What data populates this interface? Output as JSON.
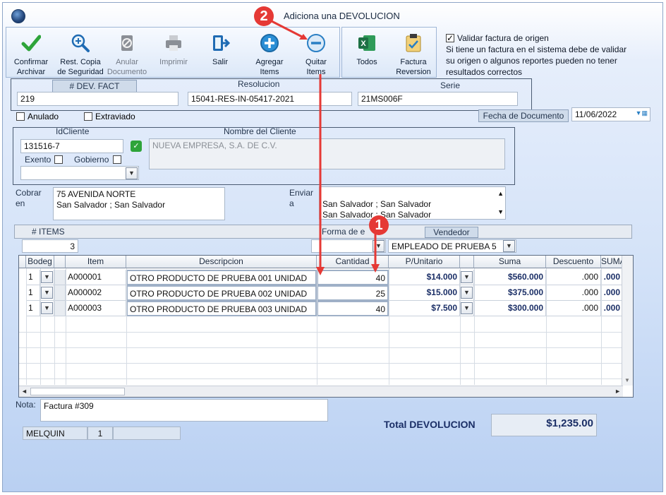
{
  "window": {
    "title": "Adiciona una DEVOLUCION"
  },
  "toolbar": {
    "confirmar": "Confirmar\nArchivar",
    "rest_copia": "Rest. Copia\nde Seguridad",
    "anular": "Anular\nDocumento",
    "imprimir": "Imprimir",
    "salir": "Salir",
    "agregar": "Agregar\nItems",
    "quitar": "Quitar\nItems",
    "todos": "Todos",
    "factura_reversion": "Factura\nReversion"
  },
  "validar": {
    "label": "Validar factura de origen",
    "checked": true,
    "note": "Si tiene un factura en el sistema debe de validar su origen o algunos reportes pueden no tener resultados correctos"
  },
  "header": {
    "dev_fact_label": "# DEV. FACT",
    "dev_fact_value": "219",
    "resolucion_label": "Resolucion",
    "resolucion_value": "15041-RES-IN-05417-2021",
    "serie_label": "Serie",
    "serie_value": "21MS006F",
    "anulado_label": "Anulado",
    "extraviado_label": "Extraviado",
    "fecha_label": "Fecha de  Documento",
    "fecha_value": "11/06/2022"
  },
  "cliente": {
    "id_label": "IdCliente",
    "id_value": "131516-7",
    "nombre_label": "Nombre del Cliente",
    "nombre_value": "NUEVA EMPRESA, S.A. DE C.V.",
    "exento_label": "Exento",
    "gobierno_label": "Gobierno"
  },
  "direcciones": {
    "cobrar_label": "Cobrar\nen",
    "cobrar_value": "75 AVENIDA NORTE\nSan Salvador ; San Salvador",
    "enviar_label": "Enviar\na",
    "enviar_line1": "San Salvador ; San Salvador",
    "enviar_line2": "San Salvador ; San Salvador"
  },
  "resumen": {
    "items_label": "# ITEMS",
    "items_value": "3",
    "forma_label": "Forma de e",
    "vendedor_label": "Vendedor",
    "vendedor_value": "EMPLEADO DE PRUEBA 5"
  },
  "grid": {
    "columns": [
      "Bodega",
      "Item",
      "Descripcion",
      "Cantidad",
      "P/Unitario",
      "Suma",
      "Descuento",
      "SUMA"
    ],
    "col_bodega_short": "Bodeg",
    "col_suma_short": "SUMA",
    "rows": [
      {
        "bodega": "1",
        "item": "A000001",
        "descripcion": "OTRO PRODUCTO DE PRUEBA 001 UNIDAD",
        "cantidad": "40",
        "punitario": "$14.000",
        "suma": "$560.000",
        "descuento": ".000",
        "suma2": ".000"
      },
      {
        "bodega": "1",
        "item": "A000002",
        "descripcion": "OTRO PRODUCTO DE PRUEBA 002 UNIDAD",
        "cantidad": "25",
        "punitario": "$15.000",
        "suma": "$375.000",
        "descuento": ".000",
        "suma2": ".000"
      },
      {
        "bodega": "1",
        "item": "A000003",
        "descripcion": "OTRO PRODUCTO DE PRUEBA 003 UNIDAD",
        "cantidad": "40",
        "punitario": "$7.500",
        "suma": "$300.000",
        "descuento": ".000",
        "suma2": ".000"
      }
    ]
  },
  "footer": {
    "nota_label": "Nota:",
    "nota_value": "Factura #309",
    "usuario": "MELQUIN",
    "usuario_num": "1",
    "total_label": "Total DEVOLUCION",
    "total_value": "$1,235.00"
  },
  "annotations": {
    "step1": "1",
    "step2": "2",
    "color": "#e53935"
  }
}
